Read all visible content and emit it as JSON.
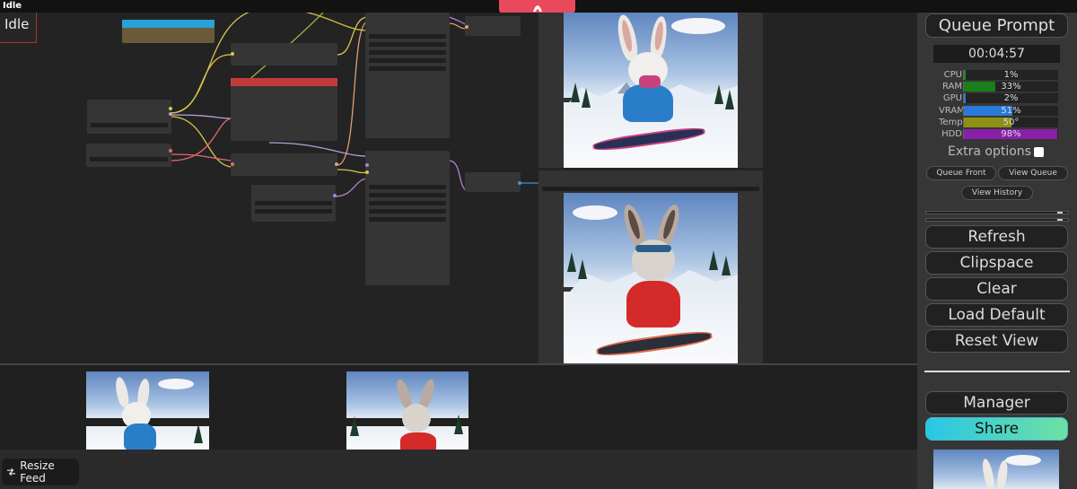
{
  "window": {
    "title": "Idle"
  },
  "canvas": {
    "status_badge": "Idle"
  },
  "menu": {
    "queue_prompt": "Queue Prompt",
    "timer": "00:04:57",
    "stats": [
      {
        "label": "CPU",
        "value": "1%",
        "fraction": 0.01,
        "color": "#1a8a1a"
      },
      {
        "label": "RAM",
        "value": "33%",
        "fraction": 0.33,
        "color": "#1a7f1a"
      },
      {
        "label": "GPU",
        "value": "2%",
        "fraction": 0.02,
        "color": "#2b79d8"
      },
      {
        "label": "VRAM",
        "value": "51%",
        "fraction": 0.51,
        "color": "#2b79d8"
      },
      {
        "label": "Temp",
        "value": "50°",
        "fraction": 0.5,
        "color": "#8f8f16"
      },
      {
        "label": "HDD",
        "value": "98%",
        "fraction": 0.98,
        "color": "#8a1fa8"
      }
    ],
    "extra_options": "Extra options",
    "queue_front": "Queue Front",
    "view_queue": "View Queue",
    "view_history": "View History",
    "refresh": "Refresh",
    "clipspace": "Clipspace",
    "clear": "Clear",
    "load_default": "Load Default",
    "reset_view": "Reset View",
    "manager": "Manager",
    "share": "Share"
  },
  "feed": {
    "resize_label": "Resize Feed"
  }
}
